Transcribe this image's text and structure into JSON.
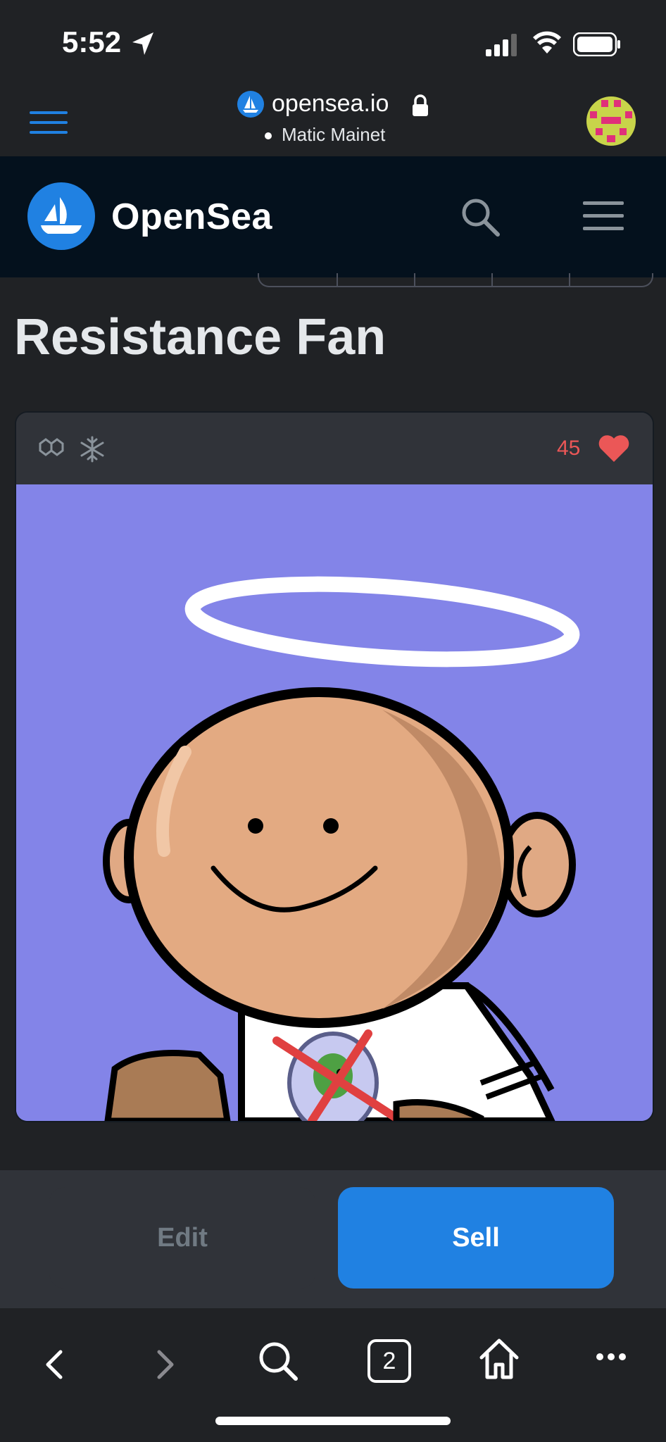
{
  "status_bar": {
    "time": "5:52"
  },
  "browser": {
    "url": "opensea.io",
    "network": "Matic Mainet",
    "tab_count": "2"
  },
  "header": {
    "brand": "OpenSea"
  },
  "page": {
    "title": "Resistance Fan"
  },
  "card": {
    "favorites": "45"
  },
  "actions": {
    "edit_label": "Edit",
    "sell_label": "Sell"
  },
  "colors": {
    "accent": "#2081e2",
    "favorite": "#eb5757",
    "art_bg": "#8384e8"
  },
  "icons": [
    "location-arrow-icon",
    "signal-icon",
    "wifi-icon",
    "battery-icon",
    "menu-icon",
    "opensea-logo-icon",
    "lock-icon",
    "avatar",
    "search-icon",
    "polygon-chain-icon",
    "frozen-metadata-icon",
    "heart-icon",
    "back-icon",
    "forward-icon",
    "tabs-icon",
    "home-icon",
    "more-icon"
  ]
}
